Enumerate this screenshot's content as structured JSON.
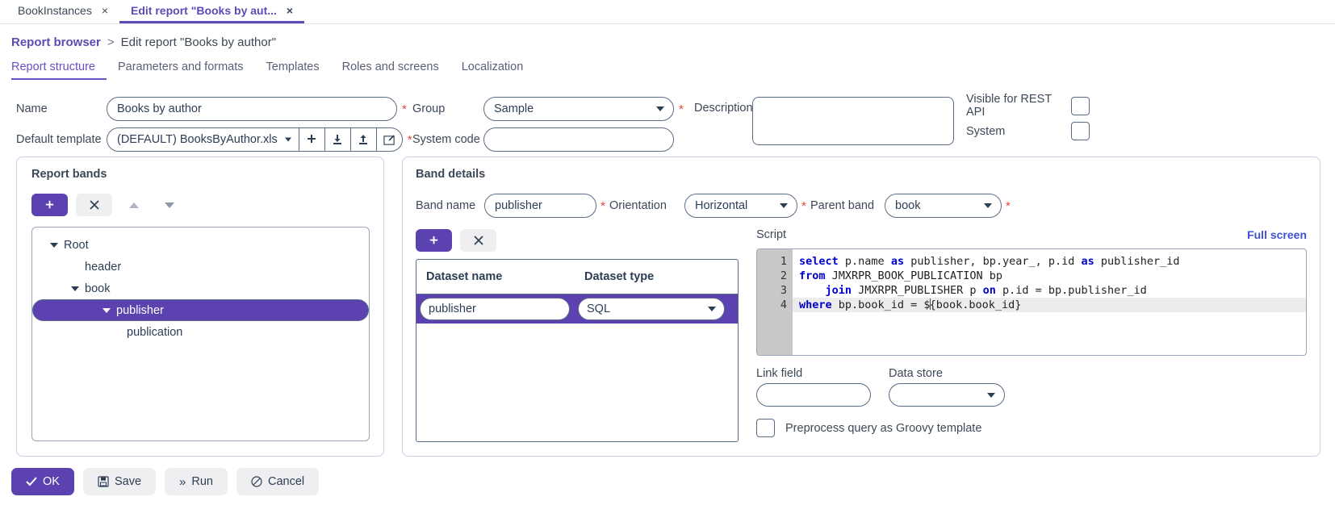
{
  "window_tabs": [
    {
      "label": "BookInstances",
      "close": "×",
      "active": false
    },
    {
      "label": "Edit report \"Books by aut...",
      "close": "×",
      "active": true
    }
  ],
  "breadcrumb": {
    "root": "Report browser",
    "separator": ">",
    "current": "Edit report \"Books by author\""
  },
  "section_tabs": [
    {
      "label": "Report structure",
      "active": true
    },
    {
      "label": "Parameters and formats",
      "active": false
    },
    {
      "label": "Templates",
      "active": false
    },
    {
      "label": "Roles and screens",
      "active": false
    },
    {
      "label": "Localization",
      "active": false
    }
  ],
  "form": {
    "name_label": "Name",
    "name_value": "Books by author",
    "name_required": "*",
    "default_template_label": "Default template",
    "default_template_value": "(DEFAULT) BooksByAuthor.xls",
    "default_template_required": "*",
    "template_buttons": [
      {
        "name": "add-template-button",
        "glyph": "✚"
      },
      {
        "name": "download-template-button",
        "glyph": "⭳"
      },
      {
        "name": "upload-template-button",
        "glyph": "⭱"
      },
      {
        "name": "edit-template-button",
        "glyph": "✎"
      }
    ],
    "group_label": "Group",
    "group_value": "Sample",
    "group_required": "*",
    "system_code_label": "System code",
    "system_code_value": "",
    "description_label": "Description",
    "description_value": "",
    "visible_rest_label": "Visible for REST API",
    "visible_rest_checked": false,
    "system_label": "System",
    "system_checked": false
  },
  "report_bands": {
    "title": "Report bands",
    "toolbar": {
      "add": "✚",
      "remove": "✖",
      "move_up": "up-arrow",
      "move_down": "down-arrow"
    },
    "tree": [
      {
        "label": "Root",
        "depth": 0,
        "expanded": true,
        "selected": false
      },
      {
        "label": "header",
        "depth": 1,
        "expanded": null,
        "selected": false
      },
      {
        "label": "book",
        "depth": 1,
        "expanded": true,
        "selected": false
      },
      {
        "label": "publisher",
        "depth": 2,
        "expanded": true,
        "selected": true
      },
      {
        "label": "publication",
        "depth": 3,
        "expanded": null,
        "selected": false
      }
    ]
  },
  "band_details": {
    "title": "Band details",
    "band_name_label": "Band name",
    "band_name_value": "publisher",
    "band_name_required": "*",
    "orientation_label": "Orientation",
    "orientation_value": "Horizontal",
    "orientation_required": "*",
    "parent_band_label": "Parent band",
    "parent_band_value": "book",
    "parent_band_required": "*",
    "toolbar": {
      "add": "✚",
      "remove": "✖"
    },
    "dataset_table": {
      "columns": [
        "Dataset name",
        "Dataset type"
      ],
      "rows": [
        {
          "name": "publisher",
          "type": "SQL",
          "selected": true
        }
      ]
    },
    "script": {
      "label": "Script",
      "fullscreen_label": "Full screen",
      "lines": [
        {
          "n": "1",
          "tokens": [
            {
              "t": "select",
              "k": true
            },
            {
              "t": " p.name ",
              "k": false
            },
            {
              "t": "as",
              "k": true
            },
            {
              "t": " publisher, bp.year_, p.id ",
              "k": false
            },
            {
              "t": "as",
              "k": true
            },
            {
              "t": " publisher_id",
              "k": false
            }
          ],
          "highlight": false
        },
        {
          "n": "2",
          "tokens": [
            {
              "t": "from",
              "k": true
            },
            {
              "t": " JMXRPR_BOOK_PUBLICATION bp",
              "k": false
            }
          ],
          "highlight": false
        },
        {
          "n": "3",
          "tokens": [
            {
              "t": "    ",
              "k": false
            },
            {
              "t": "join",
              "k": true
            },
            {
              "t": " JMXRPR_PUBLISHER p ",
              "k": false
            },
            {
              "t": "on",
              "k": true
            },
            {
              "t": " p.id = bp.publisher_id",
              "k": false
            }
          ],
          "highlight": false
        },
        {
          "n": "4",
          "tokens": [
            {
              "t": "where",
              "k": true
            },
            {
              "t": " bp.book_id = $",
              "k": false
            },
            {
              "t": "{book.book_id}",
              "k": false,
              "cursor": true
            }
          ],
          "highlight": true
        }
      ]
    },
    "link_field_label": "Link field",
    "link_field_value": "",
    "data_store_label": "Data store",
    "data_store_value": "",
    "groovy_label": "Preprocess query as Groovy template",
    "groovy_checked": false
  },
  "actions": [
    {
      "label": "OK",
      "icon": "✔",
      "style": "primary",
      "name": "ok-button"
    },
    {
      "label": "Save",
      "icon": "Ὃe",
      "style": "ghost",
      "name": "save-button"
    },
    {
      "label": "Run",
      "icon": "»",
      "style": "ghost",
      "name": "run-button"
    },
    {
      "label": "Cancel",
      "icon": "⊘",
      "style": "ghost",
      "name": "cancel-button"
    }
  ],
  "colors": {
    "accent": "#5b42b0",
    "link": "#3f51d0",
    "required": "#e8453c",
    "tab_active": "#6a4fc0"
  }
}
